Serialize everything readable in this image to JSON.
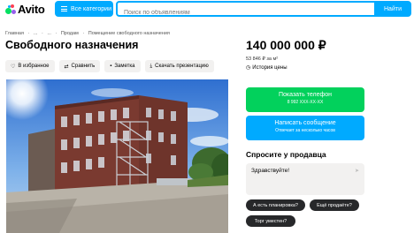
{
  "header": {
    "logo": "Avito",
    "categories_label": "Все категории",
    "search_placeholder": "Поиск по объявлениям",
    "search_value": "",
    "find_label": "Найти"
  },
  "breadcrumbs": [
    "Главная",
    "·",
    "...",
    "·",
    "...",
    "·",
    "Продам",
    "·",
    "Помещение свободного назначения"
  ],
  "listing": {
    "title": "Свободного назначения",
    "actions": [
      {
        "icon": "heart-icon",
        "label": "В избранное"
      },
      {
        "icon": "compare-icon",
        "label": "Сравнить"
      },
      {
        "icon": "note-icon",
        "label": "Заметка"
      },
      {
        "icon": "download-icon",
        "label": "Скачать презентацию"
      }
    ]
  },
  "sidebar": {
    "price": "140 000 000 ₽",
    "price_per_m2": "53 846 ₽ за м²",
    "price_history": "История цены",
    "show_phone": "Показать телефон",
    "phone_masked": "8 992 XXX-XX-XX",
    "write_message": "Написать сообщение",
    "reply_time": "Отвечает за несколько часов",
    "ask_title": "Спросите у продавца",
    "message_value": "Здравствуйте!",
    "quick_questions": [
      "А есть планировка?",
      "Ещё продаёте?",
      "Торг уместен?"
    ]
  },
  "colors": {
    "accent_blue": "#00aaff",
    "accent_green": "#02d15c",
    "chip_dark": "#27282a"
  }
}
